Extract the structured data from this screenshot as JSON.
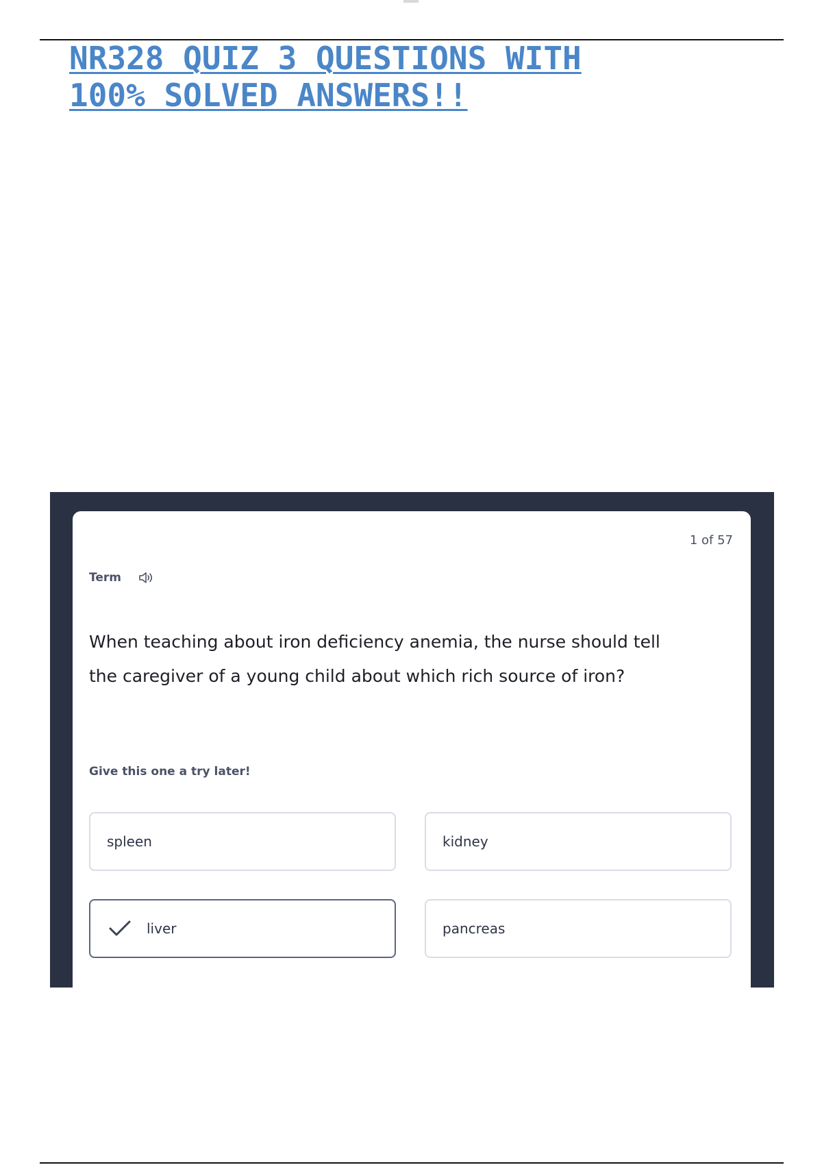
{
  "document": {
    "title_line1": "NR328 QUIZ 3 QUESTIONS WITH",
    "title_line2": "100% SOLVED ANSWERS!!",
    "title_color": "#4a86c8"
  },
  "flashcard": {
    "counter": "1 of 57",
    "term_label": "Term",
    "audio_icon": "speaker-icon",
    "question": "When teaching about iron deficiency anemia, the nurse should tell the caregiver of a young child about which rich source of iron?",
    "hint": "Give this one a try later!",
    "options": [
      {
        "label": "spleen",
        "selected": false
      },
      {
        "label": "kidney",
        "selected": false
      },
      {
        "label": "liver",
        "selected": true
      },
      {
        "label": "pancreas",
        "selected": false
      }
    ],
    "selected_icon": "checkmark-icon",
    "frame_color": "#2a3142"
  }
}
